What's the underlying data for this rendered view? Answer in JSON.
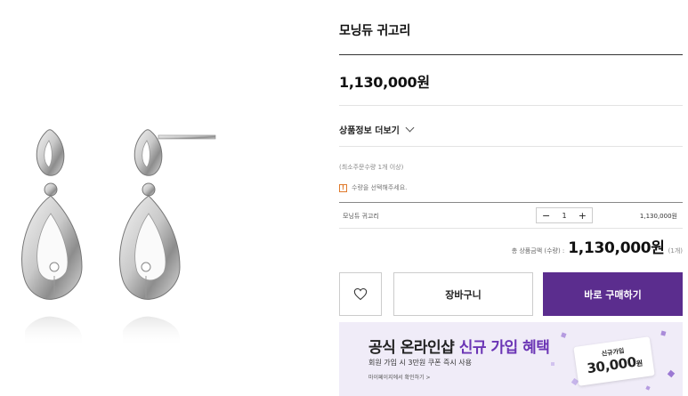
{
  "product": {
    "name": "모닝듀 귀고리",
    "price": "1,130,000원",
    "image_description_icon": "earring-image"
  },
  "detail_toggle": {
    "label": "상품정보 더보기"
  },
  "order": {
    "min_order_note": "(최소주문수량 1개 이상)",
    "warning_icon": "!",
    "warning_text": "수량을 선택해주세요."
  },
  "selected_item": {
    "name": "모닝듀 귀고리",
    "quantity": "1",
    "minus": "−",
    "plus": "+",
    "price": "1,130,000원"
  },
  "total": {
    "label": "총 상품금액 (수량) :",
    "value": "1,130,000원",
    "count": "(1개)"
  },
  "actions": {
    "wishlist_icon": "heart-icon",
    "cart_label": "장바구니",
    "buy_label": "바로 구매하기"
  },
  "banner": {
    "title_prefix": "공식 온라인샵 ",
    "title_accent": "신규 가입 혜택",
    "subtitle": "회원 가입 시 3만원 쿠폰 즉시 사용",
    "link_text": "마이페이지에서 확인하기 >",
    "coupon_label": "신규가입",
    "coupon_amount": "30,000",
    "coupon_unit": "원"
  },
  "colors": {
    "brand_purple": "#5b2d8e",
    "accent_purple": "#6b35b5",
    "banner_bg": "#f0ecf8",
    "warning_orange": "#e07a2c"
  }
}
